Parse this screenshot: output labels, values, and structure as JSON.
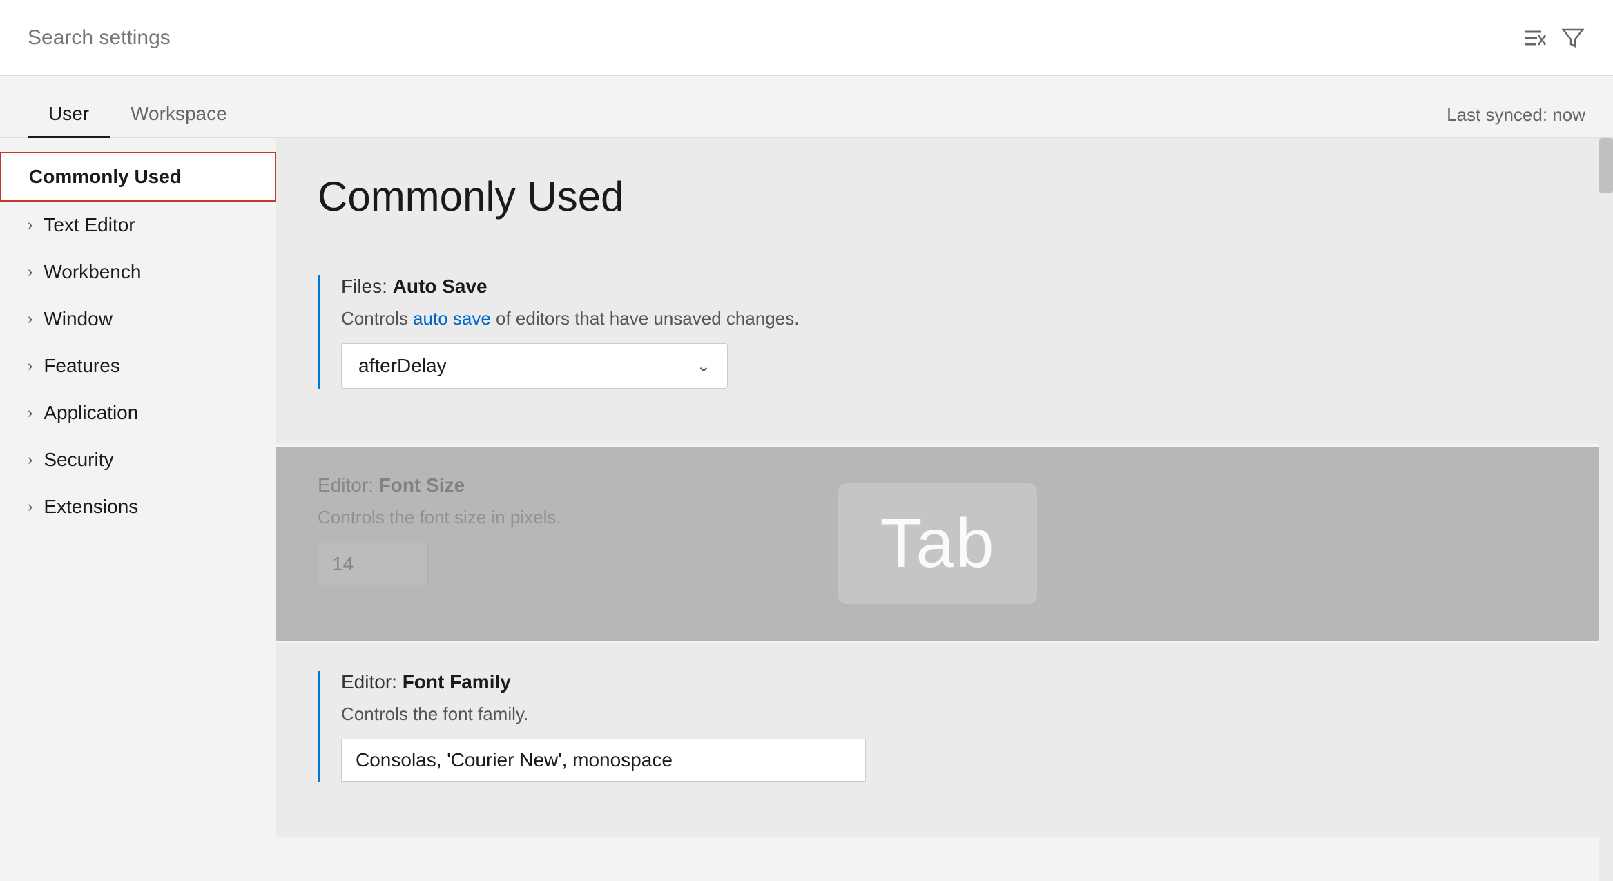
{
  "search": {
    "placeholder": "Search settings",
    "filter_icon": "filter-icon",
    "clear_icon": "clear-filter-icon"
  },
  "tabs": {
    "user_label": "User",
    "workspace_label": "Workspace",
    "last_synced": "Last synced: now"
  },
  "sidebar": {
    "items": [
      {
        "id": "commonly-used",
        "label": "Commonly Used",
        "active": true,
        "has_chevron": false
      },
      {
        "id": "text-editor",
        "label": "Text Editor",
        "active": false,
        "has_chevron": true
      },
      {
        "id": "workbench",
        "label": "Workbench",
        "active": false,
        "has_chevron": true
      },
      {
        "id": "window",
        "label": "Window",
        "active": false,
        "has_chevron": true
      },
      {
        "id": "features",
        "label": "Features",
        "active": false,
        "has_chevron": true
      },
      {
        "id": "application",
        "label": "Application",
        "active": false,
        "has_chevron": true
      },
      {
        "id": "security",
        "label": "Security",
        "active": false,
        "has_chevron": true
      },
      {
        "id": "extensions",
        "label": "Extensions",
        "active": false,
        "has_chevron": true
      }
    ]
  },
  "content": {
    "title": "Commonly Used",
    "settings": [
      {
        "id": "auto-save",
        "label_prefix": "Files: ",
        "label_bold": "Auto Save",
        "description_prefix": "Controls ",
        "description_link": "auto save",
        "description_suffix": " of editors that have unsaved changes.",
        "control_type": "select",
        "select_value": "afterDelay"
      },
      {
        "id": "font-size",
        "label_prefix": "Editor: ",
        "label_bold": "Font Size",
        "description": "Controls the font size in pixels.",
        "control_type": "number",
        "number_value": "14"
      },
      {
        "id": "font-family",
        "label_prefix": "Editor: ",
        "label_bold": "Font Family",
        "description": "Controls the font family.",
        "control_type": "text",
        "text_value": "Consolas, 'Courier New', monospace"
      }
    ]
  },
  "overlay": {
    "tab_key_label": "Tab"
  }
}
